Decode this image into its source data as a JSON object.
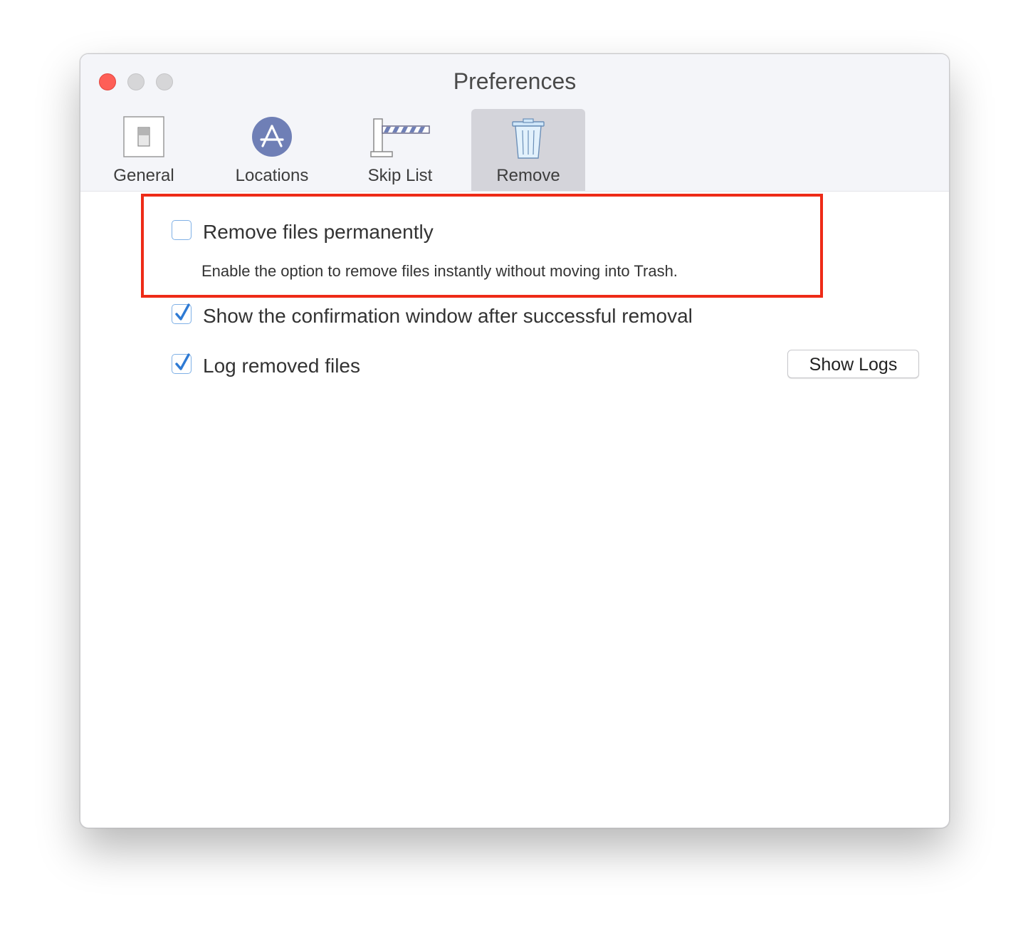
{
  "window": {
    "title": "Preferences"
  },
  "tabs": [
    {
      "label": "General",
      "icon": "switch-icon",
      "selected": false
    },
    {
      "label": "Locations",
      "icon": "app-store-icon",
      "selected": false
    },
    {
      "label": "Skip List",
      "icon": "barrier-gate-icon",
      "selected": false
    },
    {
      "label": "Remove",
      "icon": "trash-icon",
      "selected": true
    }
  ],
  "options": {
    "remove_permanently": {
      "label": "Remove files permanently",
      "description": "Enable the option to remove files instantly without moving into Trash.",
      "checked": false
    },
    "show_confirmation": {
      "label": "Show the confirmation window after successful removal",
      "checked": true
    },
    "log_removed": {
      "label": "Log removed files",
      "checked": true
    }
  },
  "buttons": {
    "show_logs": "Show Logs"
  },
  "colors": {
    "highlight": "#ee2b17",
    "checkbox_border": "#7fb0e6",
    "checkmark": "#2e7ad4",
    "close": "#fe5f57"
  }
}
